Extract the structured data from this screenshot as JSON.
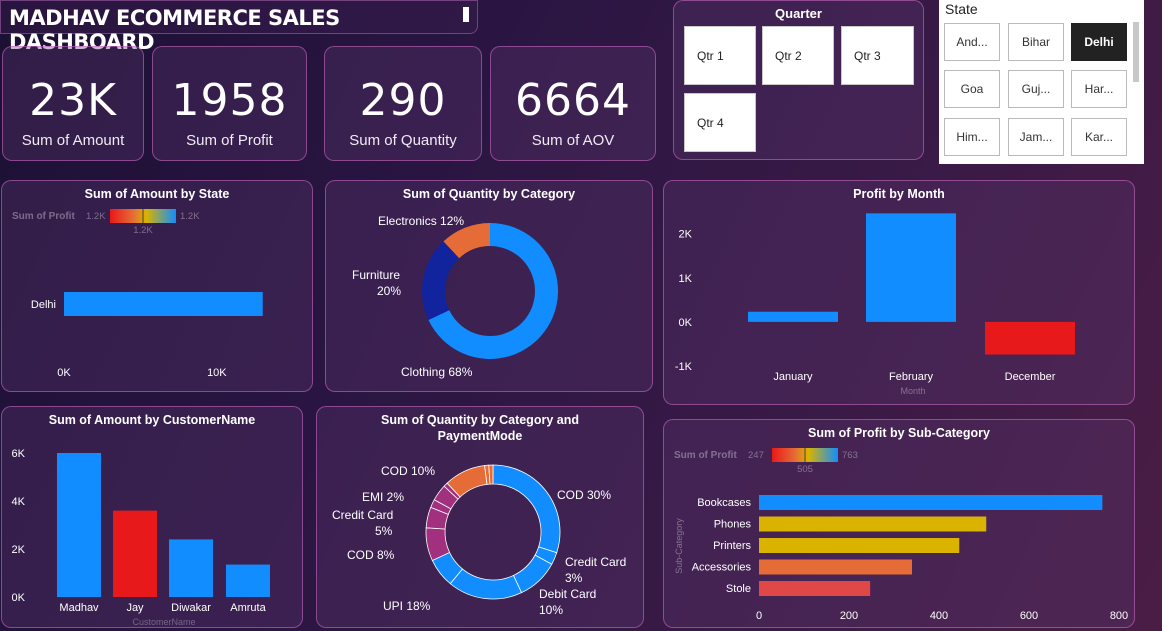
{
  "header": {
    "title": "MADHAV ECOMMERCE SALES DASHBOARD"
  },
  "kpis": [
    {
      "value": "23K",
      "label": "Sum of Amount"
    },
    {
      "value": "1958",
      "label": "Sum of Profit"
    },
    {
      "value": "290",
      "label": "Sum of Quantity"
    },
    {
      "value": "6664",
      "label": "Sum of AOV"
    }
  ],
  "quarter_slicer": {
    "title": "Quarter",
    "options": [
      "Qtr 1",
      "Qtr 2",
      "Qtr 3",
      "Qtr 4"
    ]
  },
  "state_slicer": {
    "title": "State",
    "options": [
      "And...",
      "Bihar",
      "Delhi",
      "Goa",
      "Guj...",
      "Har...",
      "Him...",
      "Jam...",
      "Kar..."
    ],
    "selected": "Delhi"
  },
  "colors": {
    "blue": "#118dff",
    "navy": "#12239e",
    "orange": "#e66c37",
    "red": "#e8191a",
    "gold": "#d9b300",
    "magenta": "#a1307f"
  },
  "chart_data": [
    {
      "id": "amount_by_state",
      "type": "bar",
      "orientation": "horizontal",
      "title": "Sum of Amount by State",
      "categories": [
        "Delhi"
      ],
      "values": [
        13000
      ],
      "xlim": [
        0,
        14000
      ],
      "xticks": [
        0,
        10000
      ],
      "xtick_labels": [
        "0K",
        "10K"
      ],
      "color_legend": {
        "label": "Sum of Profit",
        "min": "1.2K",
        "mid": "1.2K",
        "max": "1.2K"
      }
    },
    {
      "id": "quantity_by_category",
      "type": "pie",
      "donut": true,
      "title": "Sum of Quantity by Category",
      "categories": [
        "Clothing",
        "Furniture",
        "Electronics"
      ],
      "values": [
        68,
        20,
        12
      ],
      "labels": [
        "Clothing 68%",
        "Furniture 20%",
        "Electronics 12%"
      ]
    },
    {
      "id": "profit_by_month",
      "type": "bar",
      "title": "Profit by Month",
      "xlabel": "Month",
      "categories": [
        "January",
        "February",
        "December"
      ],
      "values": [
        230,
        2460,
        -740
      ],
      "ylim": [
        -1000,
        2400
      ],
      "yticks": [
        -1000,
        0,
        1000,
        2000
      ],
      "ytick_labels": [
        "-1K",
        "0K",
        "1K",
        "2K"
      ]
    },
    {
      "id": "amount_by_customer",
      "type": "bar",
      "title": "Sum of Amount by CustomerName",
      "xlabel": "CustomerName",
      "categories": [
        "Madhav",
        "Jay",
        "Diwakar",
        "Amruta"
      ],
      "values": [
        6000,
        3600,
        2400,
        1350
      ],
      "ylim": [
        0,
        6500
      ],
      "yticks": [
        0,
        2000,
        4000,
        6000
      ],
      "ytick_labels": [
        "0K",
        "2K",
        "4K",
        "6K"
      ]
    },
    {
      "id": "quantity_by_category_payment",
      "type": "pie",
      "donut": true,
      "title": "Sum of Quantity by Category and PaymentMode",
      "slices": [
        {
          "category": "Clothing",
          "mode": "COD",
          "value": 30,
          "label": "COD 30%"
        },
        {
          "category": "Clothing",
          "mode": "Credit Card",
          "value": 3,
          "label": "Credit Card 3%"
        },
        {
          "category": "Clothing",
          "mode": "Debit Card",
          "value": 10,
          "label": "Debit Card 10%"
        },
        {
          "category": "Clothing",
          "mode": "UPI",
          "value": 18,
          "label": "UPI 18%"
        },
        {
          "category": "Clothing",
          "mode": "EMI",
          "value": 7,
          "label": ""
        },
        {
          "category": "Furniture",
          "mode": "COD",
          "value": 8,
          "label": "COD 8%"
        },
        {
          "category": "Furniture",
          "mode": "Credit Card",
          "value": 5,
          "label": "Credit Card 5%"
        },
        {
          "category": "Furniture",
          "mode": "EMI",
          "value": 2,
          "label": "EMI 2%"
        },
        {
          "category": "Furniture",
          "mode": "UPI",
          "value": 4,
          "label": ""
        },
        {
          "category": "Furniture",
          "mode": "Debit Card",
          "value": 1,
          "label": ""
        },
        {
          "category": "Electronics",
          "mode": "COD",
          "value": 10,
          "label": "COD 10%"
        },
        {
          "category": "Electronics",
          "mode": "UPI",
          "value": 1,
          "label": ""
        },
        {
          "category": "Electronics",
          "mode": "Credit Card",
          "value": 1,
          "label": ""
        }
      ]
    },
    {
      "id": "profit_by_subcategory",
      "type": "bar",
      "orientation": "horizontal",
      "title": "Sum of Profit by Sub-Category",
      "ylabel": "Sub-Category",
      "categories": [
        "Bookcases",
        "Phones",
        "Printers",
        "Accessories",
        "Stole"
      ],
      "values": [
        763,
        505,
        445,
        340,
        247
      ],
      "xlim": [
        0,
        800
      ],
      "xticks": [
        0,
        200,
        400,
        600,
        800
      ],
      "xtick_labels": [
        "0",
        "200",
        "400",
        "600",
        "800"
      ],
      "color_legend": {
        "label": "Sum of Profit",
        "min": "247",
        "mid": "505",
        "max": "763"
      }
    }
  ]
}
